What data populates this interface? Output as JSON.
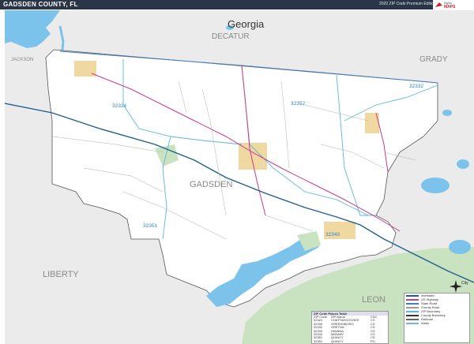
{
  "header": {
    "title": "GADSDEN COUNTY, FL",
    "edition": "2020 ZIP Code Premium Edition",
    "brand_top": "Digital",
    "brand_main": "MAPS"
  },
  "labels": {
    "state_georgia": "Georgia",
    "county_decatur": "DECATUR",
    "county_grady": "GRADY",
    "county_jackson": "JACKSON",
    "county_gadsden": "GADSDEN",
    "county_liberty": "LIBERTY",
    "county_leon": "LEON"
  },
  "zips": [
    "32324",
    "32352",
    "32332",
    "32351",
    "32343"
  ],
  "legend": {
    "header": "ZIP Code Places Table",
    "columns": [
      "ZIP Code",
      "ZIP Name",
      "CSC"
    ],
    "rows": [
      [
        "32324",
        "CHATTAHOOCHEE",
        "CS"
      ],
      [
        "32330",
        "GREENSBORO",
        "CS"
      ],
      [
        "32332",
        "GRETNA",
        "CS"
      ],
      [
        "32333",
        "HAVANA",
        "CS"
      ],
      [
        "32343",
        "MIDWAY",
        "CS"
      ],
      [
        "32351",
        "QUINCY",
        "CS"
      ],
      [
        "32352",
        "QUINCY",
        "PO"
      ],
      [
        "32353",
        "QUINCY",
        "PO"
      ]
    ]
  },
  "key": {
    "items": [
      {
        "label": "Interstate",
        "color": "#1f5f8c"
      },
      {
        "label": "US Highway",
        "color": "#c83c8c"
      },
      {
        "label": "State Road",
        "color": "#3f7fbf"
      },
      {
        "label": "County Road",
        "color": "#9a9a9a"
      },
      {
        "label": "ZIP Boundary",
        "color": "#59b6e0"
      },
      {
        "label": "County Boundary",
        "color": "#333333"
      },
      {
        "label": "Railroad",
        "color": "#666666"
      },
      {
        "label": "Water",
        "color": "#6fb9e6"
      }
    ]
  },
  "compass_label": "City",
  "colors": {
    "water": "#7cc3ec",
    "county_bg": "#ffffff",
    "outside_bg": "#ebebeb",
    "interstate": "#1f5f8c",
    "highway": "#c83c8c",
    "zipline": "#59b6e0",
    "urban": "#f0d9a0",
    "park": "#c9e3c0"
  }
}
